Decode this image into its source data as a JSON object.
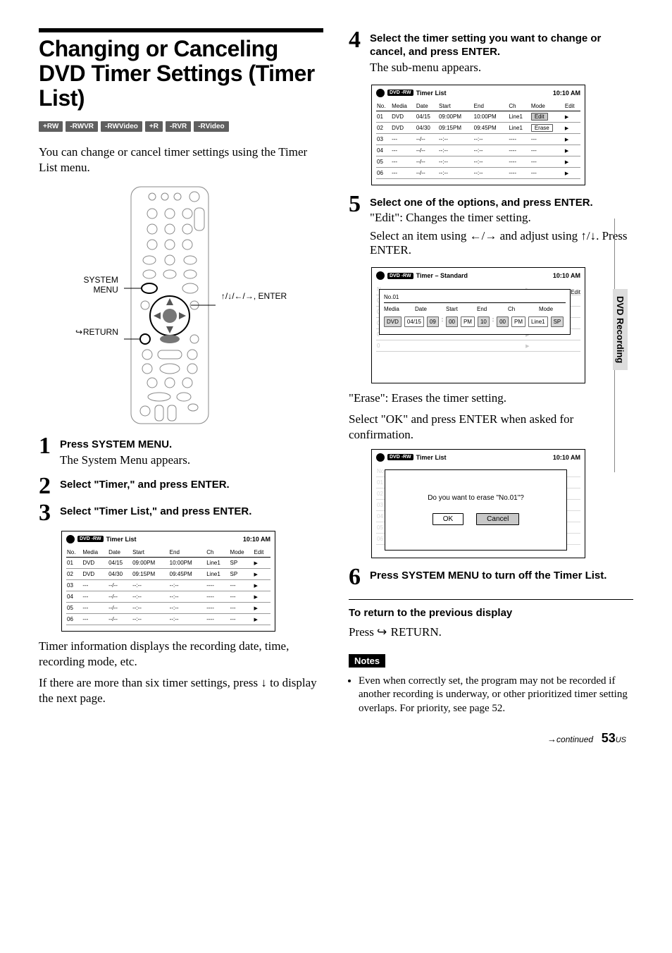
{
  "title": "Changing or Canceling DVD Timer Settings (Timer List)",
  "badges": [
    "+RW",
    "-RWVR",
    "-RWVideo",
    "+R",
    "-RVR",
    "-RVideo"
  ],
  "intro": "You can change or cancel timer settings using the Timer List menu.",
  "remote": {
    "left1": "SYSTEM\nMENU",
    "left2_prefix": "RETURN",
    "right": "↑/↓/←/→,\nENTER"
  },
  "steps": [
    {
      "num": "1",
      "head": "Press SYSTEM MENU.",
      "sub": "The System Menu appears."
    },
    {
      "num": "2",
      "head": "Select \"Timer,\" and press ENTER."
    },
    {
      "num": "3",
      "head": "Select \"Timer List,\" and press ENTER."
    }
  ],
  "osd_common": {
    "time": "10:10 AM",
    "disc_label": "DVD\n-RW",
    "cols": [
      "No.",
      "Media",
      "Date",
      "Start",
      "End",
      "Ch",
      "Mode",
      "Edit"
    ]
  },
  "osd_list_plain": {
    "title": "Timer List",
    "rows": [
      {
        "no": "01",
        "media": "DVD",
        "date": "04/15",
        "start": "09:00PM",
        "end": "10:00PM",
        "ch": "Line1",
        "mode": "SP"
      },
      {
        "no": "02",
        "media": "DVD",
        "date": "04/30",
        "start": "09:15PM",
        "end": "09:45PM",
        "ch": "Line1",
        "mode": "SP"
      },
      {
        "no": "03",
        "media": "---",
        "date": "--/--",
        "start": "--:--",
        "end": "--:--",
        "ch": "----",
        "mode": "---"
      },
      {
        "no": "04",
        "media": "---",
        "date": "--/--",
        "start": "--:--",
        "end": "--:--",
        "ch": "----",
        "mode": "---"
      },
      {
        "no": "05",
        "media": "---",
        "date": "--/--",
        "start": "--:--",
        "end": "--:--",
        "ch": "----",
        "mode": "---"
      },
      {
        "no": "06",
        "media": "---",
        "date": "--/--",
        "start": "--:--",
        "end": "--:--",
        "ch": "----",
        "mode": "---"
      }
    ]
  },
  "step3_after": [
    "Timer information displays the recording date, time, recording mode, etc.",
    "If there are more than six timer settings, press ↓ to display the next page."
  ],
  "step4": {
    "num": "4",
    "head": "Select the timer setting you want to change or cancel, and press ENTER.",
    "sub": "The sub-menu appears."
  },
  "osd_list_sel": {
    "title": "Timer List",
    "selected_row_actions": [
      "Edit",
      "Erase"
    ]
  },
  "step5": {
    "num": "5",
    "head": "Select one of the options, and press ENTER.",
    "edit_line1": "\"Edit\": Changes the timer setting.",
    "edit_line2": "Select an item using ←/→ and adjust using ↑/↓. Press ENTER."
  },
  "osd_edit": {
    "title": "Timer – Standard",
    "card_title": "No.01",
    "labels": [
      "Media",
      "Date",
      "Start",
      "End",
      "Ch",
      "Mode"
    ],
    "values": {
      "media": "DVD",
      "date": "04/15",
      "sh": "09",
      "sm": "00",
      "sap": "PM",
      "eh": "10",
      "em": "00",
      "eap": "PM",
      "ch": "Line1",
      "mode": "SP"
    },
    "side_label": "Edit"
  },
  "erase": {
    "line1": "\"Erase\": Erases the timer setting.",
    "line2": "Select \"OK\" and press ENTER when asked for confirmation.",
    "dialog_text": "Do you want to erase \"No.01\"?",
    "ok": "OK",
    "cancel": "Cancel",
    "osd_title": "Timer List"
  },
  "step6": {
    "num": "6",
    "head": "Press SYSTEM MENU to turn off the Timer List."
  },
  "return": {
    "head": "To return to the previous display",
    "body_prefix": "Press ",
    "body_suffix": " RETURN."
  },
  "notes_label": "Notes",
  "notes": [
    "Even when correctly set, the program may not be recorded if another recording is underway, or other prioritized timer setting overlaps. For priority, see page 52."
  ],
  "side_tab": "DVD Recording",
  "footer": {
    "cont": "continued",
    "page": "53",
    "region": "US"
  }
}
